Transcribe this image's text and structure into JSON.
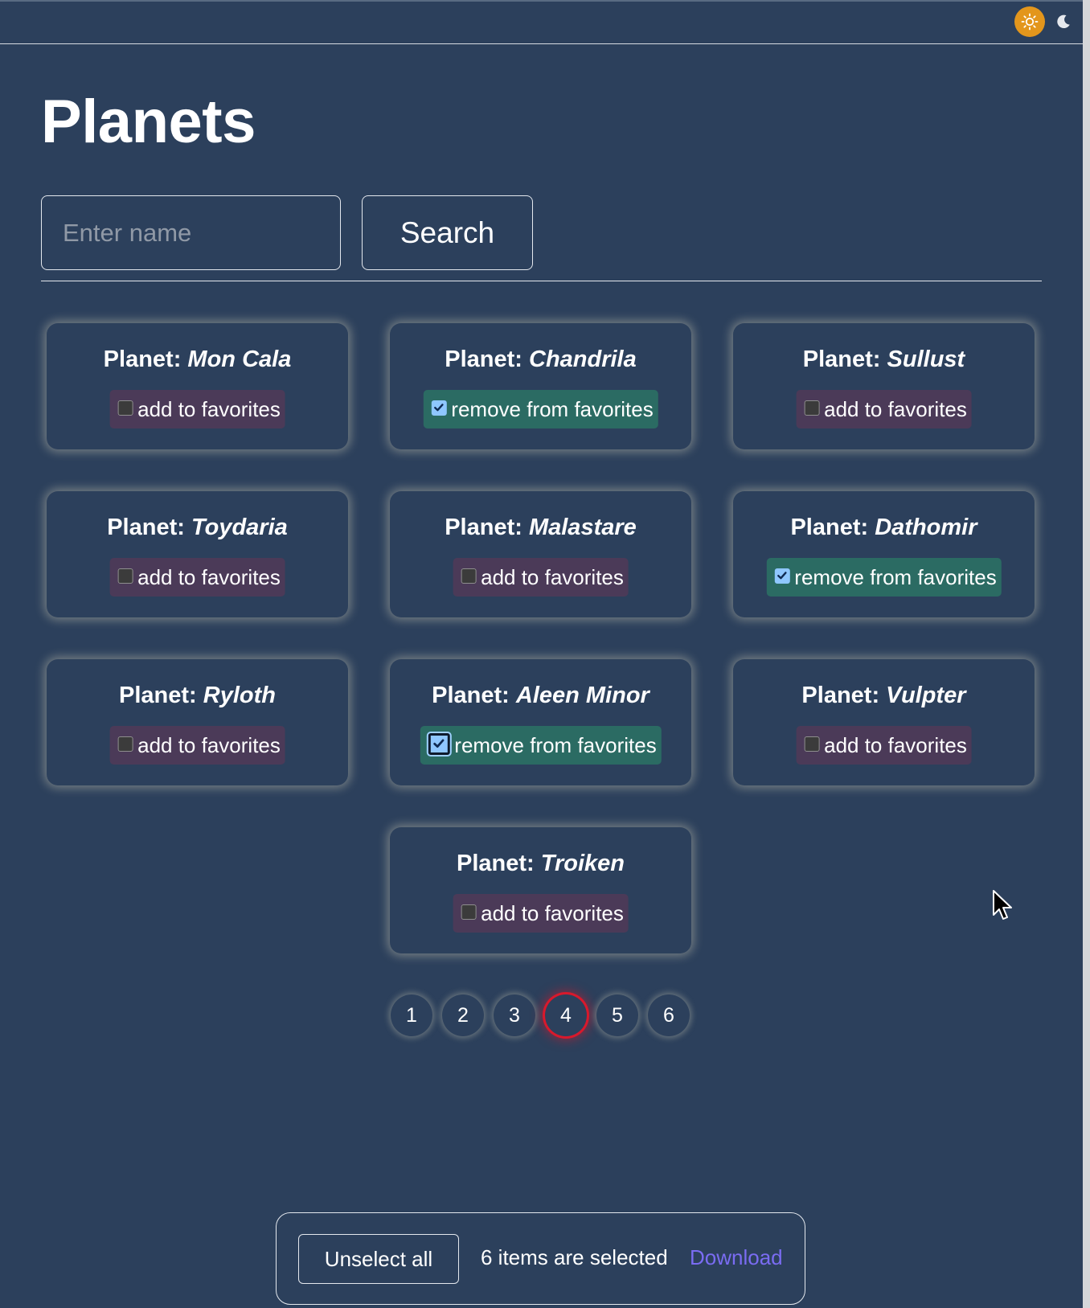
{
  "header": {
    "theme_light_icon": "sun-icon",
    "theme_dark_icon": "moon-icon",
    "accent_color": "#e3961c"
  },
  "page": {
    "title": "Planets"
  },
  "search": {
    "placeholder": "Enter name",
    "value": "",
    "button_label": "Search"
  },
  "cards": [
    {
      "label": "Planet: ",
      "name": "Mon Cala",
      "favorite": false,
      "toggle_label": "add to favorites"
    },
    {
      "label": "Planet: ",
      "name": "Chandrila",
      "favorite": true,
      "toggle_label": "remove from favorites"
    },
    {
      "label": "Planet: ",
      "name": "Sullust",
      "favorite": false,
      "toggle_label": "add to favorites"
    },
    {
      "label": "Planet: ",
      "name": "Toydaria",
      "favorite": false,
      "toggle_label": "add to favorites"
    },
    {
      "label": "Planet: ",
      "name": "Malastare",
      "favorite": false,
      "toggle_label": "add to favorites"
    },
    {
      "label": "Planet: ",
      "name": "Dathomir",
      "favorite": true,
      "toggle_label": "remove from favorites"
    },
    {
      "label": "Planet: ",
      "name": "Ryloth",
      "favorite": false,
      "toggle_label": "add to favorites"
    },
    {
      "label": "Planet: ",
      "name": "Aleen Minor",
      "favorite": true,
      "toggle_label": "remove from favorites"
    },
    {
      "label": "Planet: ",
      "name": "Vulpter",
      "favorite": false,
      "toggle_label": "add to favorites"
    },
    {
      "label": "Planet: ",
      "name": "Troiken",
      "favorite": false,
      "toggle_label": "add to favorites"
    }
  ],
  "pagination": {
    "pages": [
      "1",
      "2",
      "3",
      "4",
      "5",
      "6"
    ],
    "current": "4",
    "active_color": "#d8192c"
  },
  "selection": {
    "unselect_label": "Unselect all",
    "count_text": "6 items are selected",
    "download_label": "Download",
    "download_color": "#7a6cf2"
  },
  "colors": {
    "background": "#2c405c",
    "favorite_on": "#2b6b63",
    "favorite_off": "#4b3a58"
  }
}
